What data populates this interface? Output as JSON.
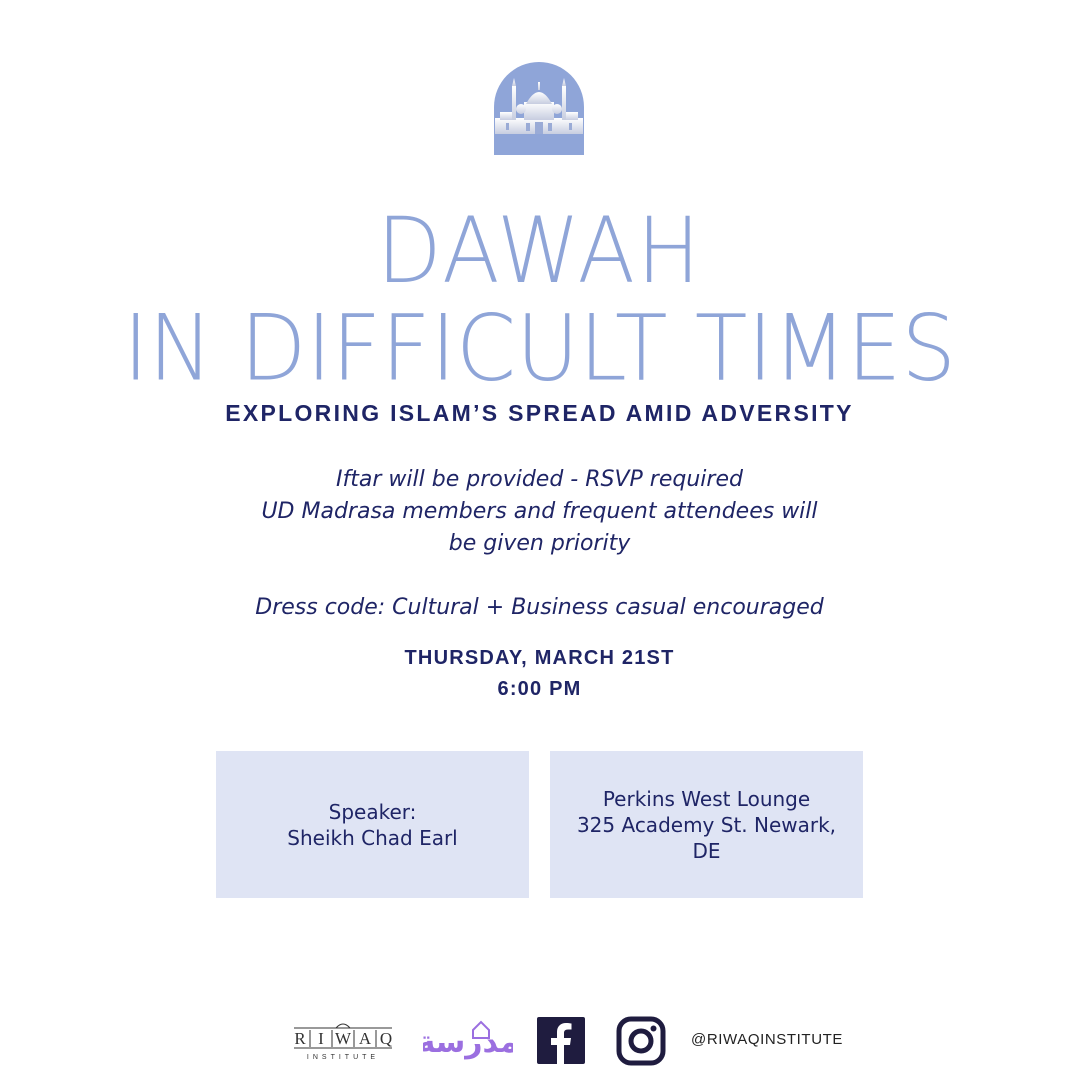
{
  "colors": {
    "title": "#8fa5d8",
    "navy": "#1f2566",
    "card_bg": "#dfe4f4",
    "emblem": "#8fa5d8"
  },
  "emblem": {
    "icon": "mosque-icon"
  },
  "title": {
    "line1": "DAWAH",
    "line2": "IN DIFFICULT TIMES"
  },
  "subtitle": "EXPLORING ISLAM’S SPREAD AMID ADVERSITY",
  "info": {
    "iftar": "Iftar will be provided - RSVP required",
    "members_line1": "UD Madrasa members and frequent attendees will",
    "members_line2": "be given priority",
    "dress_code": "Dress code: Cultural + Business casual encouraged"
  },
  "when": {
    "date": "THURSDAY, MARCH 21ST",
    "time": "6:00 PM"
  },
  "speaker": {
    "label": "Speaker:",
    "name": "Sheikh Chad Earl"
  },
  "venue": {
    "line1": "Perkins West Lounge",
    "line2": "325 Academy St. Newark,",
    "line3": "DE"
  },
  "footer": {
    "riwaq_logo_letters": [
      "R",
      "I",
      "W",
      "A",
      "Q"
    ],
    "riwaq_logo_sub": "INSTITUTE",
    "madrasa_logo": "مدرسة",
    "facebook": "facebook-icon",
    "instagram": "instagram-icon",
    "handle": "@RIWAQINSTITUTE"
  }
}
